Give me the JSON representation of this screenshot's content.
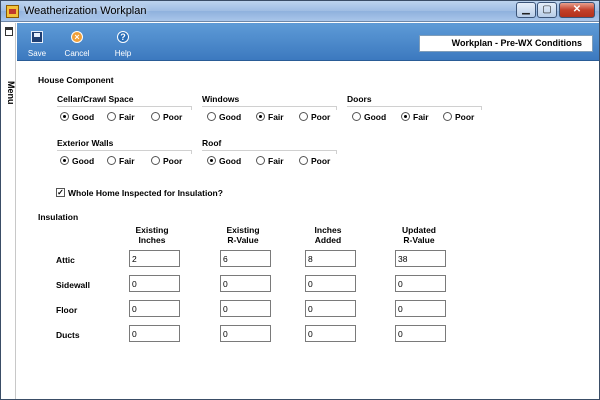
{
  "window": {
    "title": "Weatherization Workplan",
    "min_symbol": "▁",
    "max_symbol": "▢",
    "close_symbol": "✕"
  },
  "sidebar": {
    "menu_label": "Menu",
    "pin_icon": "pin-icon"
  },
  "toolbar": {
    "save_label": "Save",
    "cancel_label": "Cancel",
    "help_label": "Help",
    "header_title": "Workplan - Pre-WX Conditions"
  },
  "house_component": {
    "title": "House Component",
    "groups": [
      {
        "label": "Cellar/Crawl Space",
        "options": [
          "Good",
          "Fair",
          "Poor"
        ],
        "selected": "Good"
      },
      {
        "label": "Windows",
        "options": [
          "Good",
          "Fair",
          "Poor"
        ],
        "selected": "Fair"
      },
      {
        "label": "Doors",
        "options": [
          "Good",
          "Fair",
          "Poor"
        ],
        "selected": "Fair"
      },
      {
        "label": "Exterior Walls",
        "options": [
          "Good",
          "Fair",
          "Poor"
        ],
        "selected": "Good"
      },
      {
        "label": "Roof",
        "options": [
          "Good",
          "Fair",
          "Poor"
        ],
        "selected": "Good"
      }
    ],
    "whole_home_label": "Whole Home Inspected for Insulation?",
    "whole_home_checked": true
  },
  "insulation": {
    "title": "Insulation",
    "columns": [
      [
        "Existing",
        "Inches"
      ],
      [
        "Existing",
        "R-Value"
      ],
      [
        "Inches",
        "Added"
      ],
      [
        "Updated",
        "R-Value"
      ]
    ],
    "rows": [
      {
        "label": "Attic",
        "values": [
          "2",
          "6",
          "8",
          "38"
        ]
      },
      {
        "label": "Sidewall",
        "values": [
          "0",
          "0",
          "0",
          "0"
        ]
      },
      {
        "label": "Floor",
        "values": [
          "0",
          "0",
          "0",
          "0"
        ]
      },
      {
        "label": "Ducts",
        "values": [
          "0",
          "0",
          "0",
          "0"
        ]
      }
    ]
  }
}
